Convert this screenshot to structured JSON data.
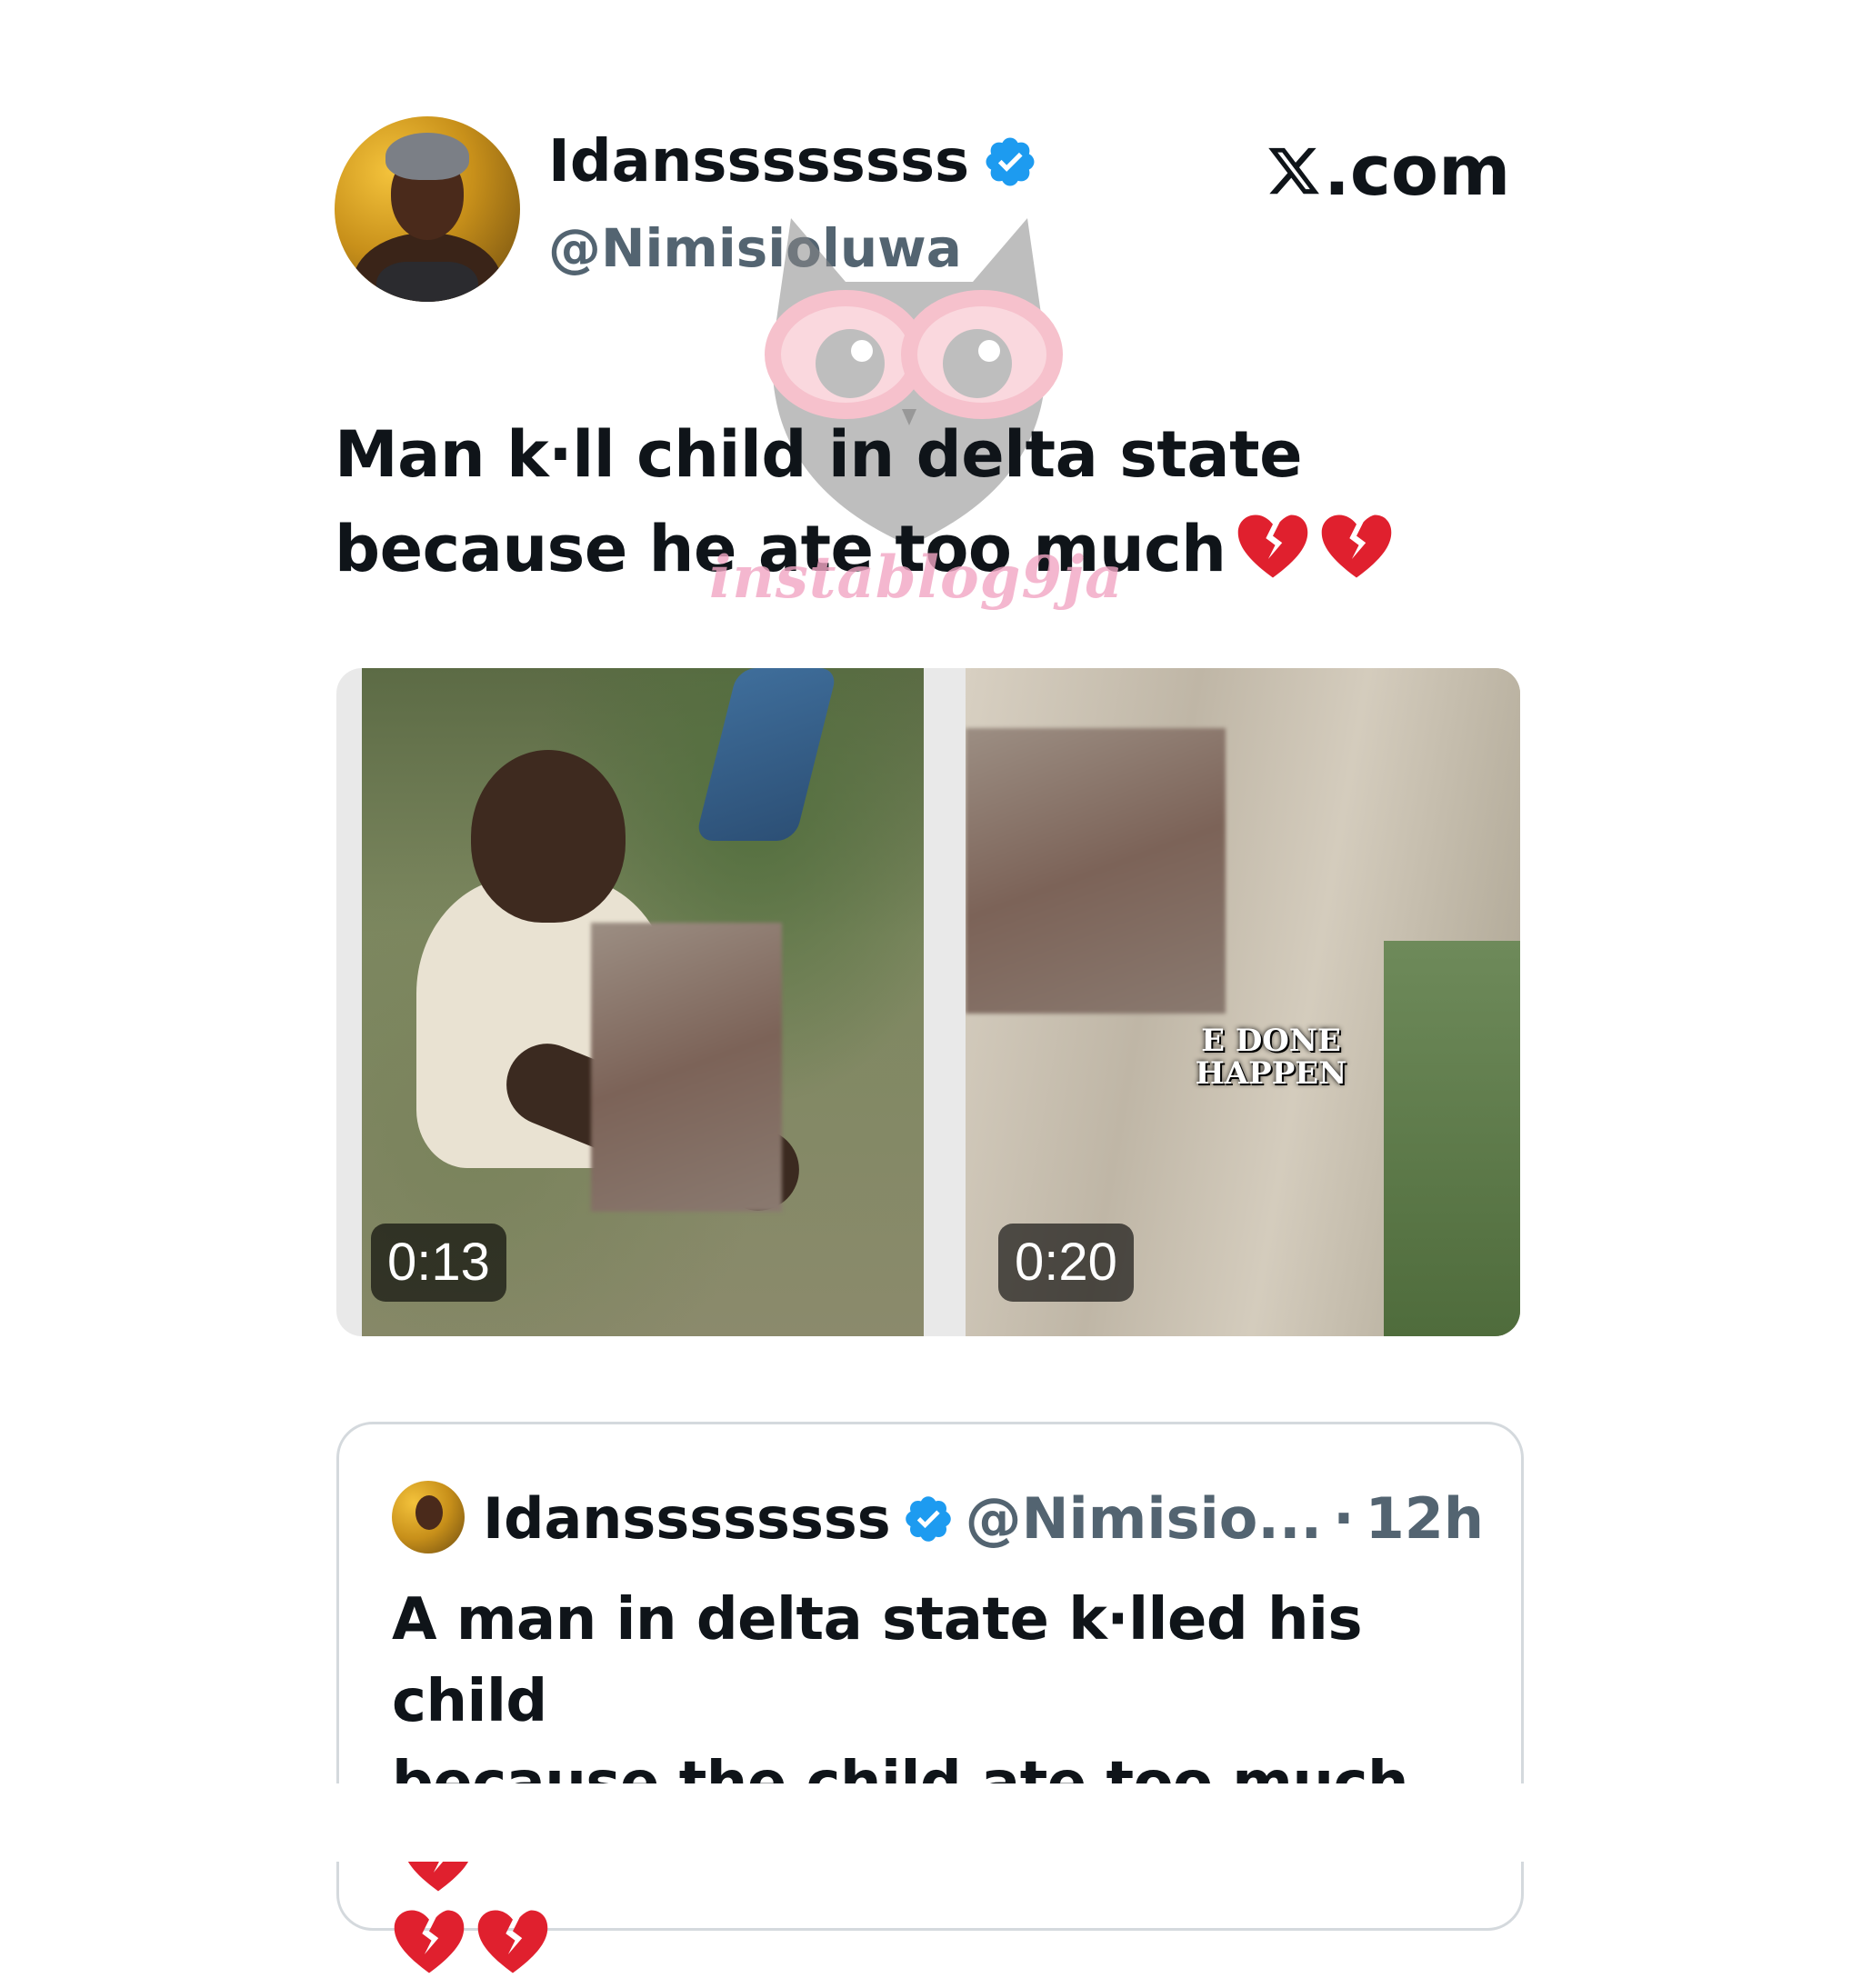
{
  "post": {
    "display_name": "Idanssssssss",
    "handle": "@Nimisioluwa",
    "site_label": ".com",
    "text_line1": "Man k·ll child in delta state",
    "text_line2": "because he ate too much"
  },
  "watermark": {
    "text": "instablog9ja"
  },
  "media": [
    {
      "duration": "0:13"
    },
    {
      "duration": "0:20",
      "caption_line1": "E DONE",
      "caption_line2": "HAPPEN"
    }
  ],
  "quoted": {
    "display_name": "Idanssssssss",
    "handle": "@Nimisio...",
    "dot": "·",
    "time": "12h",
    "text_line1": "A man in delta state k·lled his child",
    "text_line2": "because the child ate too much"
  },
  "colors": {
    "verified": "#1d9bf0",
    "secondary_text": "#536471",
    "heart": "#e0202e"
  },
  "icons": [
    "verified-badge-icon",
    "x-logo-icon",
    "broken-heart-icon"
  ]
}
